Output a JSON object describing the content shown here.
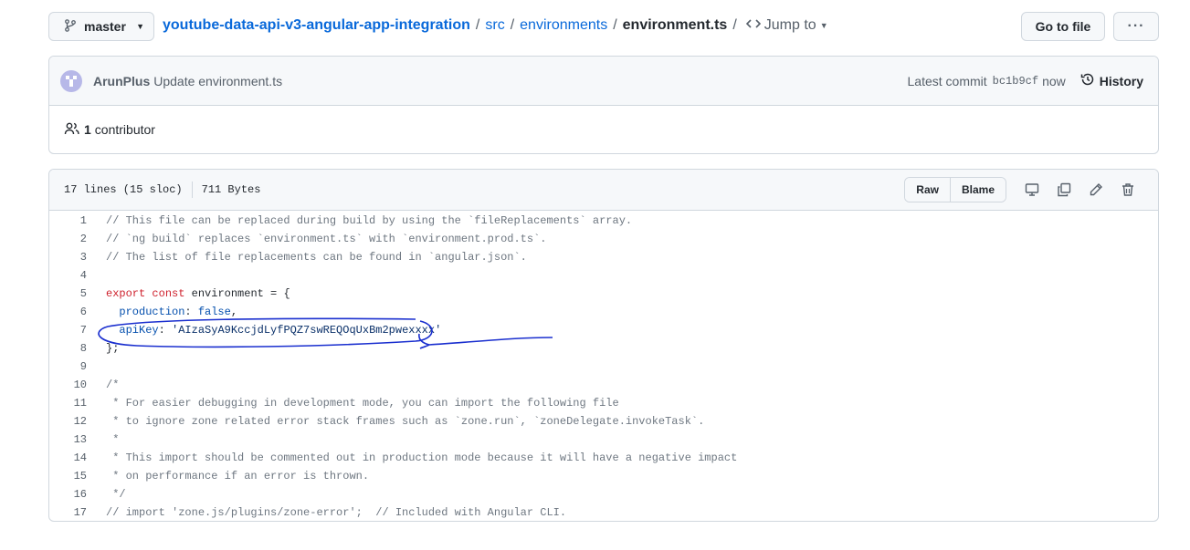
{
  "header": {
    "branch": "master",
    "breadcrumb": {
      "repo": "youtube-data-api-v3-angular-app-integration",
      "seg1": "src",
      "seg2": "environments",
      "file": "environment.ts",
      "jump": "Jump to"
    },
    "goto_label": "Go to file",
    "more_label": "···"
  },
  "commit": {
    "author": "ArunPlus",
    "message": "Update environment.ts",
    "latest_label": "Latest commit",
    "sha": "bc1b9cf",
    "time": "now",
    "history_label": "History"
  },
  "contributors": {
    "count": "1",
    "label": "contributor"
  },
  "file": {
    "lines_info": "17 lines (15 sloc)",
    "size": "711 Bytes",
    "raw_label": "Raw",
    "blame_label": "Blame"
  },
  "code_lines": [
    {
      "num": "1",
      "parts": [
        {
          "t": "// This file can be replaced during build by using the `fileReplacements` array.",
          "c": "c-comment"
        }
      ]
    },
    {
      "num": "2",
      "parts": [
        {
          "t": "// `ng build` replaces `environment.ts` with `environment.prod.ts`.",
          "c": "c-comment"
        }
      ]
    },
    {
      "num": "3",
      "parts": [
        {
          "t": "// The list of file replacements can be found in `angular.json`.",
          "c": "c-comment"
        }
      ]
    },
    {
      "num": "4",
      "parts": [
        {
          "t": "",
          "c": ""
        }
      ]
    },
    {
      "num": "5",
      "parts": [
        {
          "t": "export",
          "c": "c-key"
        },
        {
          "t": " ",
          "c": ""
        },
        {
          "t": "const",
          "c": "c-key"
        },
        {
          "t": " environment = {",
          "c": ""
        }
      ]
    },
    {
      "num": "6",
      "parts": [
        {
          "t": "  ",
          "c": ""
        },
        {
          "t": "production",
          "c": "c-prop"
        },
        {
          "t": ": ",
          "c": ""
        },
        {
          "t": "false",
          "c": "c-prop"
        },
        {
          "t": ",",
          "c": ""
        }
      ]
    },
    {
      "num": "7",
      "parts": [
        {
          "t": "  ",
          "c": ""
        },
        {
          "t": "apiKey",
          "c": "c-prop"
        },
        {
          "t": ": ",
          "c": ""
        },
        {
          "t": "'AIzaSyA9KccjdLyfPQZ7swREQOqUxBm2pwexxxx'",
          "c": "c-str"
        }
      ]
    },
    {
      "num": "8",
      "parts": [
        {
          "t": "};",
          "c": ""
        }
      ]
    },
    {
      "num": "9",
      "parts": [
        {
          "t": "",
          "c": ""
        }
      ]
    },
    {
      "num": "10",
      "parts": [
        {
          "t": "/*",
          "c": "c-comment"
        }
      ]
    },
    {
      "num": "11",
      "parts": [
        {
          "t": " * For easier debugging in development mode, you can import the following file",
          "c": "c-comment"
        }
      ]
    },
    {
      "num": "12",
      "parts": [
        {
          "t": " * to ignore zone related error stack frames such as `zone.run`, `zoneDelegate.invokeTask`.",
          "c": "c-comment"
        }
      ]
    },
    {
      "num": "13",
      "parts": [
        {
          "t": " *",
          "c": "c-comment"
        }
      ]
    },
    {
      "num": "14",
      "parts": [
        {
          "t": " * This import should be commented out in production mode because it will have a negative impact",
          "c": "c-comment"
        }
      ]
    },
    {
      "num": "15",
      "parts": [
        {
          "t": " * on performance if an error is thrown.",
          "c": "c-comment"
        }
      ]
    },
    {
      "num": "16",
      "parts": [
        {
          "t": " */",
          "c": "c-comment"
        }
      ]
    },
    {
      "num": "17",
      "parts": [
        {
          "t": "// import 'zone.js/plugins/zone-error';  // Included with Angular CLI.",
          "c": "c-comment"
        }
      ]
    }
  ],
  "colors": {
    "link": "#0969da",
    "annotation": "#1a2fcf"
  }
}
